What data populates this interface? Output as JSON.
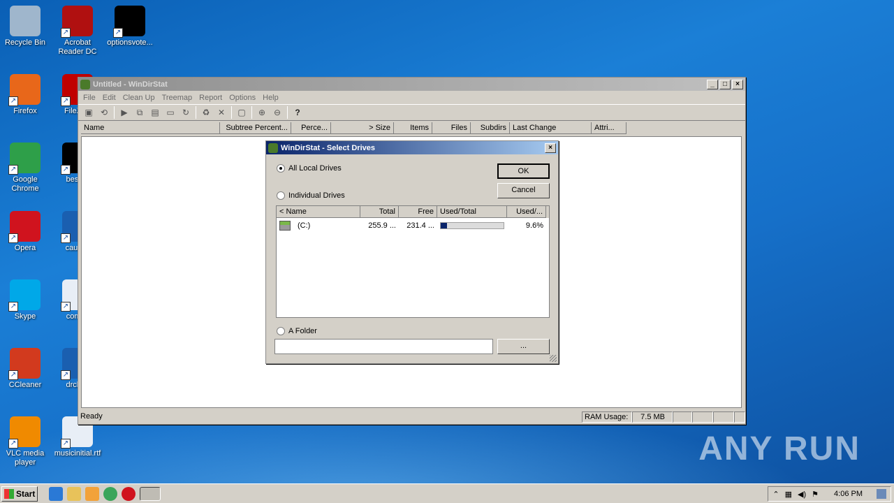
{
  "desktop": {
    "icons": [
      {
        "label": "Recycle Bin",
        "icon": "recycle-bin-icon",
        "color": "#9fb6cc"
      },
      {
        "label": "Acrobat Reader DC",
        "icon": "acrobat-icon",
        "color": "#b01010"
      },
      {
        "label": "optionsvote...",
        "icon": "file-icon",
        "color": "#000000"
      },
      {
        "label": "Firefox",
        "icon": "firefox-icon",
        "color": "#e8671a"
      },
      {
        "label": "FileZilla",
        "icon": "filezilla-icon",
        "color": "#c00000"
      },
      {
        "label": "Google Chrome",
        "icon": "chrome-icon",
        "color": "#2e9f49"
      },
      {
        "label": "besthe",
        "icon": "file-icon",
        "color": "#000000"
      },
      {
        "label": "Opera",
        "icon": "opera-icon",
        "color": "#d0131e"
      },
      {
        "label": "causes",
        "icon": "file-icon",
        "color": "#1a5fb0"
      },
      {
        "label": "Skype",
        "icon": "skype-icon",
        "color": "#00a8e8"
      },
      {
        "label": "commi",
        "icon": "word-icon",
        "color": "#e8eef6"
      },
      {
        "label": "CCleaner",
        "icon": "ccleaner-icon",
        "color": "#d23a1e"
      },
      {
        "label": "drcloth",
        "icon": "file-icon",
        "color": "#1a5fb0"
      },
      {
        "label": "VLC media player",
        "icon": "vlc-icon",
        "color": "#f08a00"
      },
      {
        "label": "musicinitial.rtf",
        "icon": "word-icon",
        "color": "#e8eef6"
      }
    ],
    "watermark": "ANY RUN"
  },
  "main_window": {
    "title": "Untitled - WinDirStat",
    "menu": [
      "File",
      "Edit",
      "Clean Up",
      "Treemap",
      "Report",
      "Options",
      "Help"
    ],
    "columns": [
      "Name",
      "Subtree Percent...",
      "Perce...",
      "> Size",
      "Items",
      "Files",
      "Subdirs",
      "Last Change",
      "Attri..."
    ],
    "status": "Ready",
    "ram_label": "RAM Usage:",
    "ram_value": "7.5 MB"
  },
  "dialog": {
    "title": "WinDirStat - Select Drives",
    "option_all": "All Local Drives",
    "option_individual": "Individual Drives",
    "option_folder": "A Folder",
    "ok_label": "OK",
    "cancel_label": "Cancel",
    "browse_label": "...",
    "folder_value": "",
    "columns": [
      "< Name",
      "Total",
      "Free",
      "Used/Total",
      "Used/..."
    ],
    "drives": [
      {
        "name": "(C:)",
        "total": "255.9 ...",
        "free": "231.4 ...",
        "used_fraction": 0.096,
        "used_pct": "9.6%"
      }
    ]
  },
  "taskbar": {
    "start_label": "Start",
    "time": "4:06 PM"
  }
}
